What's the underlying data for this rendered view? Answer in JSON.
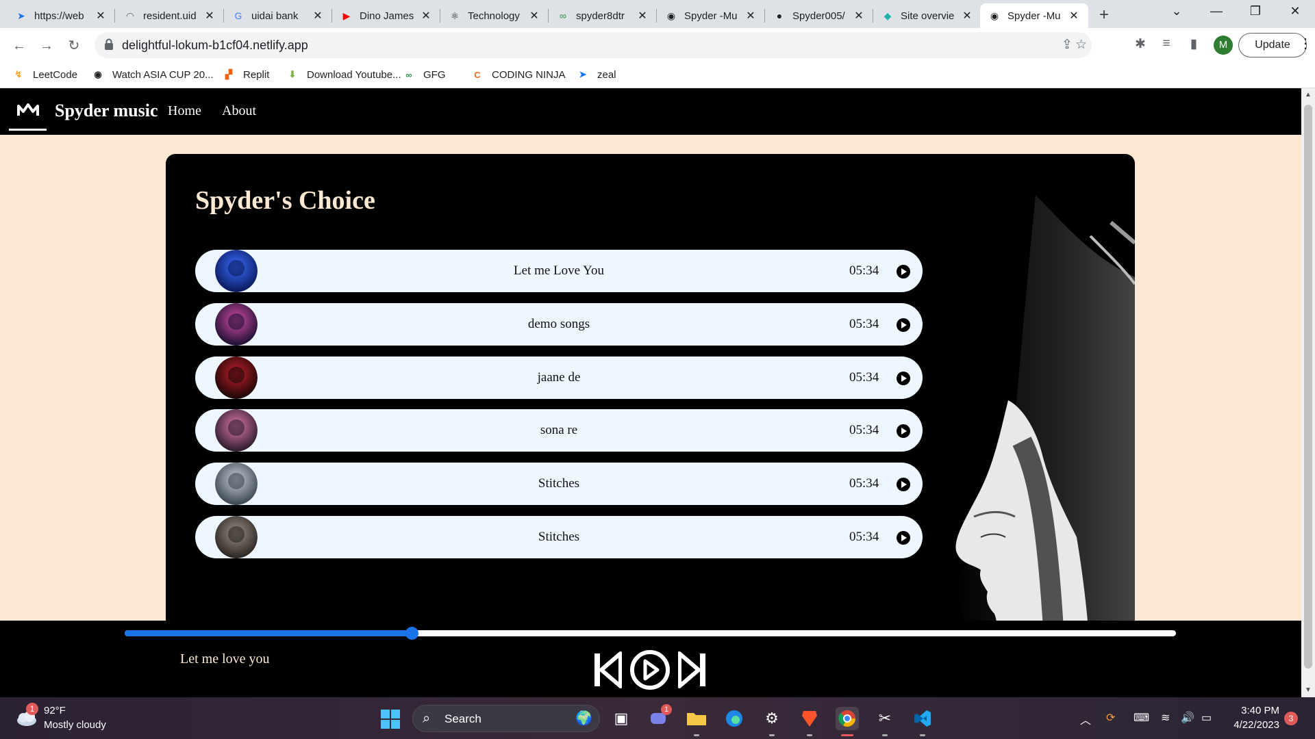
{
  "browser": {
    "tabs": [
      {
        "title": "https://web",
        "icon": "vscode-web-icon",
        "color": "#1a73e8"
      },
      {
        "title": "resident.uid",
        "icon": "wifi-icon",
        "color": "#5f6368"
      },
      {
        "title": "uidai bank",
        "icon": "google-icon",
        "color": "#4285f4"
      },
      {
        "title": "Dino James",
        "icon": "youtube-icon",
        "color": "#ff0000"
      },
      {
        "title": "Technology",
        "icon": "react-icon",
        "color": "#222222"
      },
      {
        "title": "spyder8dtr",
        "icon": "geeksforgeeks-icon",
        "color": "#2f8d46"
      },
      {
        "title": "Spyder -Mu",
        "icon": "globe-icon",
        "color": "#202124"
      },
      {
        "title": "Spyder005/",
        "icon": "github-icon",
        "color": "#202124"
      },
      {
        "title": "Site overvie",
        "icon": "netlify-icon",
        "color": "#20b2aa"
      },
      {
        "title": "Spyder -Mu",
        "icon": "globe-icon",
        "color": "#202124"
      }
    ],
    "active_tab_index": 9,
    "url": "delightful-lokum-b1cf04.netlify.app",
    "update_label": "Update",
    "profile_initial": "M",
    "bookmarks": [
      {
        "label": "LeetCode",
        "icon": "leetcode-icon",
        "color": "#f89f1b"
      },
      {
        "label": "Watch ASIA CUP 20...",
        "icon": "globe-icon",
        "color": "#202124"
      },
      {
        "label": "Replit",
        "icon": "replit-icon",
        "color": "#f26207"
      },
      {
        "label": "Download Youtube...",
        "icon": "download-icon",
        "color": "#7cb342"
      },
      {
        "label": "GFG",
        "icon": "geeksforgeeks-icon",
        "color": "#2f8d46"
      },
      {
        "label": "CODING NINJA",
        "icon": "coding-ninja-icon",
        "color": "#f26b21"
      },
      {
        "label": "zeal",
        "icon": "zeal-icon",
        "color": "#1a73e8"
      }
    ]
  },
  "site": {
    "brand": "Spyder music",
    "nav": [
      "Home",
      "About"
    ],
    "section_title": "Spyder's Choice",
    "songs": [
      {
        "name": "Let me Love You",
        "duration": "05:34",
        "cover_colors": [
          "#0a1a5a",
          "#3a6cff"
        ]
      },
      {
        "name": "demo songs",
        "duration": "05:34",
        "cover_colors": [
          "#1a1030",
          "#d64ca8"
        ]
      },
      {
        "name": "jaane de",
        "duration": "05:34",
        "cover_colors": [
          "#1a0606",
          "#c0202a"
        ]
      },
      {
        "name": "sona re",
        "duration": "05:34",
        "cover_colors": [
          "#2a1a2a",
          "#e07ab0"
        ]
      },
      {
        "name": "Stitches",
        "duration": "05:34",
        "cover_colors": [
          "#3a4550",
          "#c8d0d8"
        ]
      },
      {
        "name": "Stitches",
        "duration": "05:34",
        "cover_colors": [
          "#2a2420",
          "#9a9088"
        ]
      }
    ],
    "player": {
      "now_playing": "Let me love you",
      "progress": 0.273,
      "accent": "#1a73e8"
    }
  },
  "taskbar": {
    "weather_temp": "92°F",
    "weather_condition": "Mostly cloudy",
    "weather_badge": "1",
    "search_label": "Search",
    "chat_badge": "1",
    "time": "3:40 PM",
    "date": "4/22/2023",
    "notification_count": "3"
  }
}
